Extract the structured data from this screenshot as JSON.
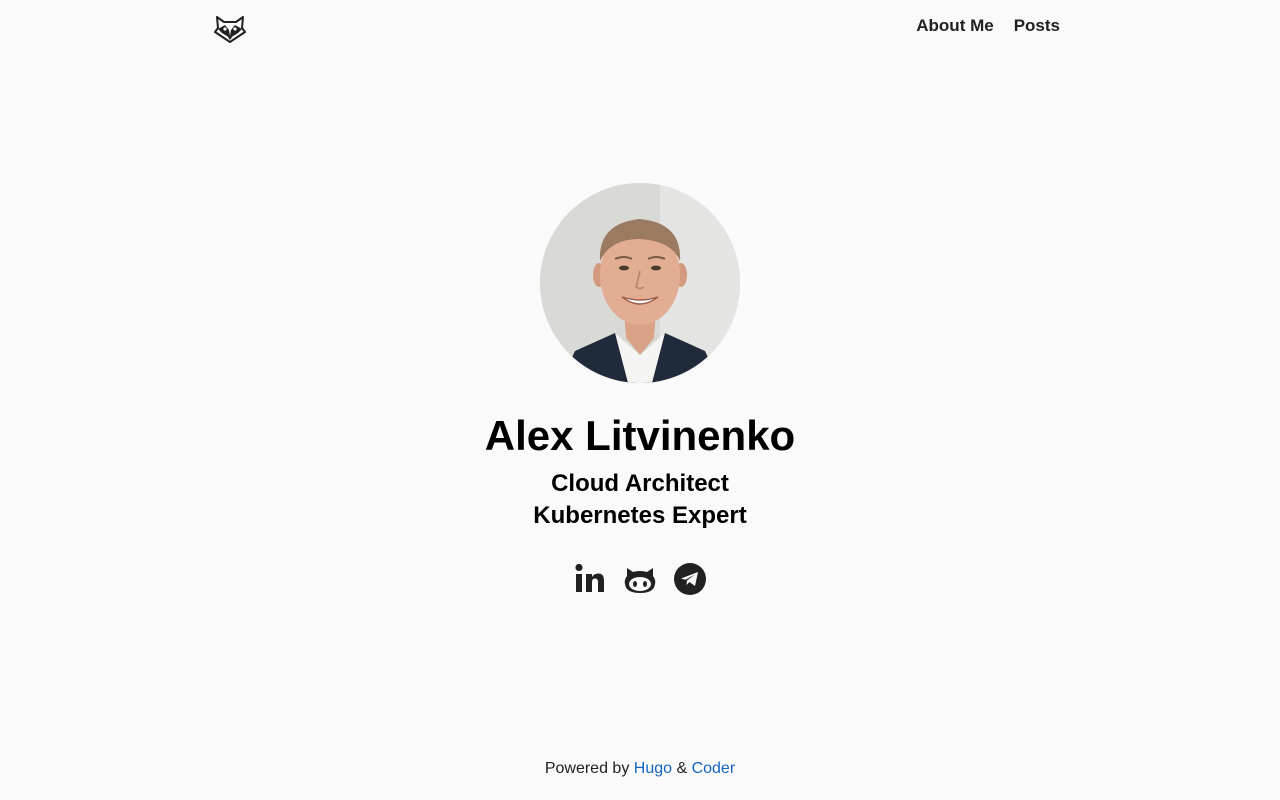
{
  "nav": {
    "logo_icon": "raccoon-logo-icon",
    "links": [
      {
        "label": "About Me"
      },
      {
        "label": "Posts"
      }
    ]
  },
  "profile": {
    "name": "Alex Litvinenko",
    "tagline_1": "Cloud Architect",
    "tagline_2": "Kubernetes Expert",
    "avatar_icon": "profile-photo"
  },
  "social": [
    {
      "icon": "linkedin-icon"
    },
    {
      "icon": "github-icon"
    },
    {
      "icon": "telegram-icon"
    }
  ],
  "footer": {
    "prefix": "Powered by ",
    "hugo_label": "Hugo",
    "amp": " & ",
    "coder_label": "Coder"
  },
  "colors": {
    "background": "#fafafa",
    "text": "#212121",
    "link": "#1565c0"
  }
}
